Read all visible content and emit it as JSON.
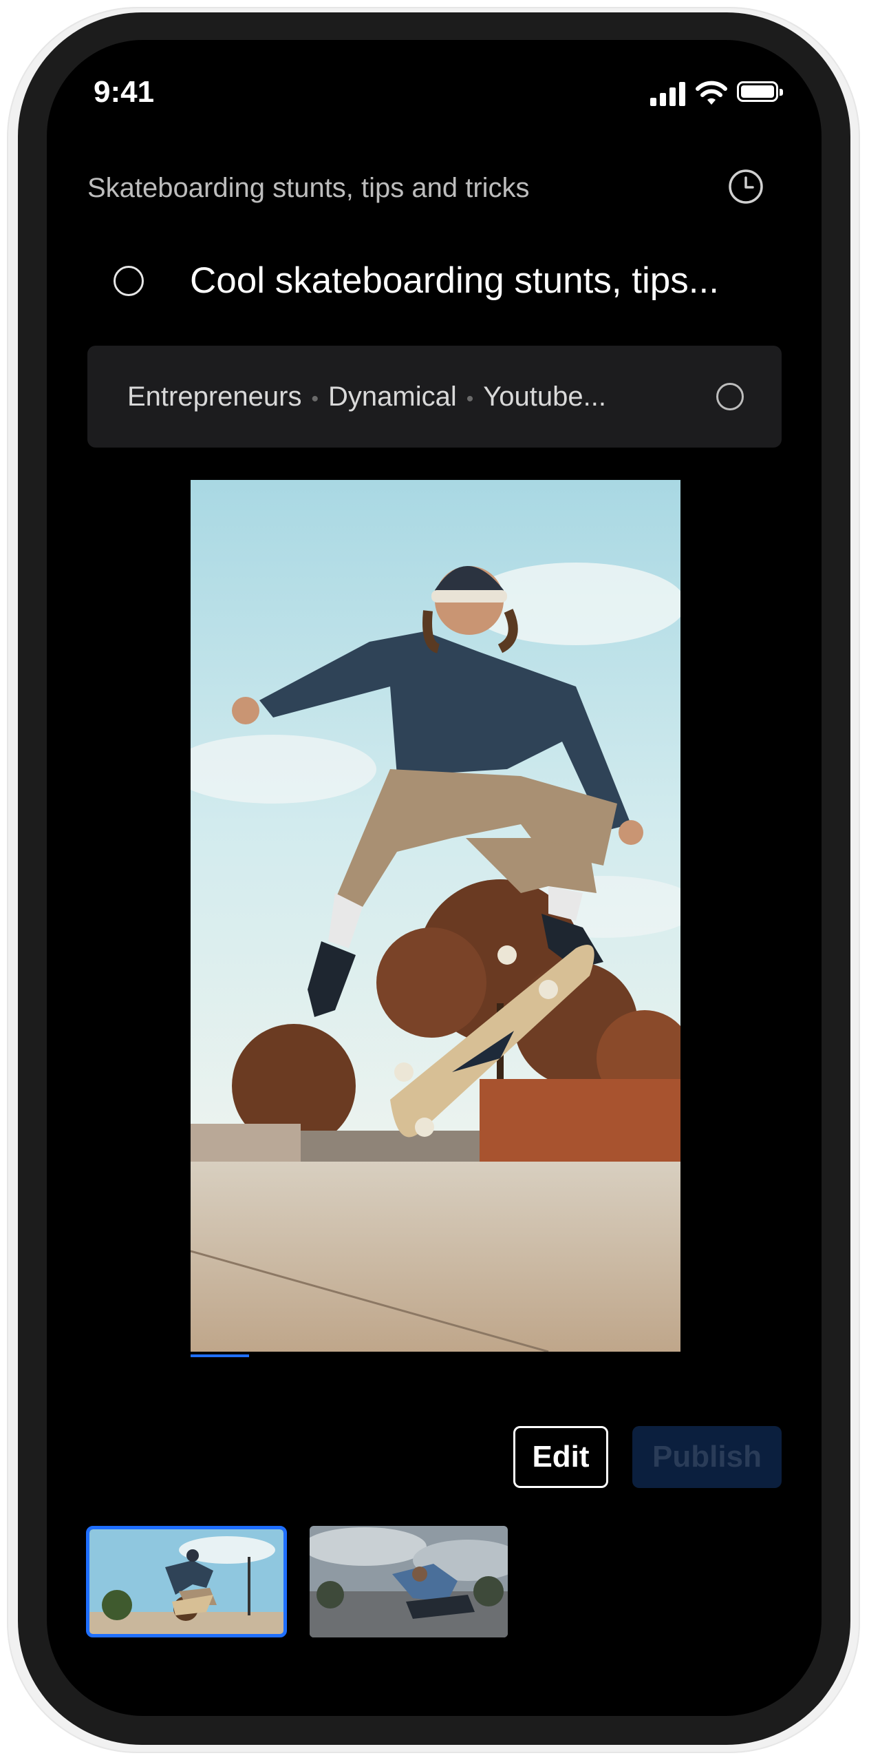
{
  "status_bar": {
    "time": "9:41"
  },
  "header": {
    "subtitle": "Skateboarding stunts, tips and tricks"
  },
  "draft": {
    "title": "Cool skateboarding stunts, tips..."
  },
  "tags": [
    "Entrepreneurs",
    "Dynamical",
    "Youtube..."
  ],
  "actions": {
    "edit_label": "Edit",
    "publish_label": "Publish"
  },
  "video": {
    "progress_fraction": 0.12
  },
  "thumbnails": {
    "selected_index": 0
  },
  "colors": {
    "accent": "#1f6fff",
    "publish_disabled_bg": "#0b1f3e",
    "background": "#000000"
  },
  "icons": {
    "history": "clock-icon",
    "signal": "cellular-signal-icon",
    "wifi": "wifi-icon",
    "battery": "battery-icon"
  }
}
